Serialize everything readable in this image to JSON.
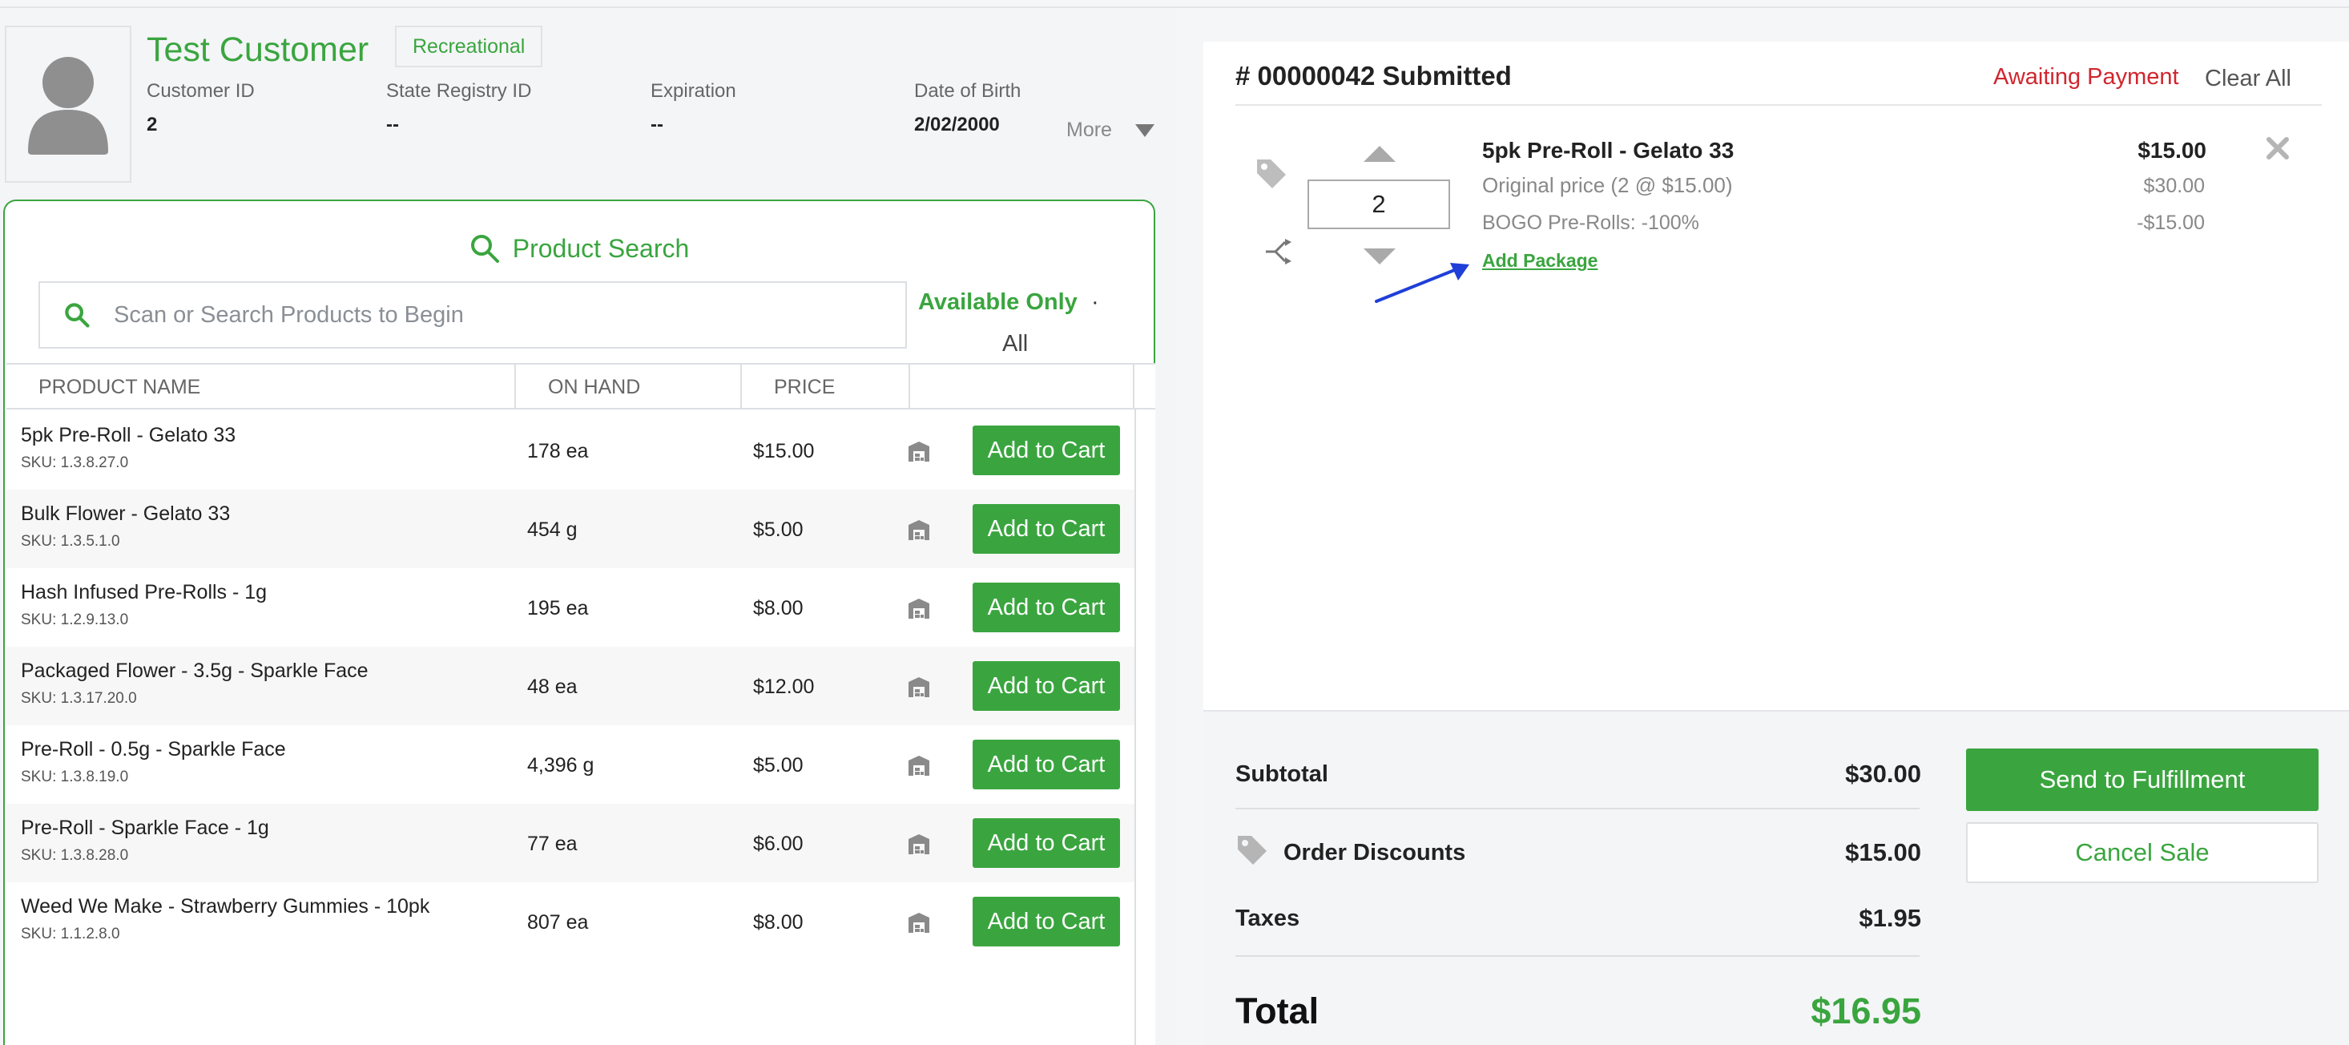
{
  "customer": {
    "name": "Test Customer",
    "type_badge": "Recreational",
    "fields": [
      {
        "label": "Customer ID",
        "value": "2"
      },
      {
        "label": "State Registry ID",
        "value": "--"
      },
      {
        "label": "Expiration",
        "value": "--"
      },
      {
        "label": "Date of Birth",
        "value": "2/02/2000"
      }
    ],
    "more_label": "More"
  },
  "search": {
    "title": "Product Search",
    "placeholder": "Scan or Search Products to Begin",
    "filter_available": "Available Only",
    "filter_separator": "·",
    "filter_all": "All"
  },
  "table": {
    "headers": [
      "PRODUCT NAME",
      "ON HAND",
      "PRICE"
    ],
    "add_label": "Add to Cart",
    "rows": [
      {
        "name": "5pk Pre-Roll - Gelato 33",
        "sku": "SKU: 1.3.8.27.0",
        "on_hand": "178 ea",
        "price": "$15.00"
      },
      {
        "name": "Bulk Flower - Gelato 33",
        "sku": "SKU: 1.3.5.1.0",
        "on_hand": "454 g",
        "price": "$5.00"
      },
      {
        "name": "Hash Infused Pre-Rolls - 1g",
        "sku": "SKU: 1.2.9.13.0",
        "on_hand": "195 ea",
        "price": "$8.00"
      },
      {
        "name": "Packaged Flower - 3.5g - Sparkle Face",
        "sku": "SKU: 1.3.17.20.0",
        "on_hand": "48 ea",
        "price": "$12.00"
      },
      {
        "name": "Pre-Roll - 0.5g - Sparkle Face",
        "sku": "SKU: 1.3.8.19.0",
        "on_hand": "4,396 g",
        "price": "$5.00"
      },
      {
        "name": "Pre-Roll - Sparkle Face - 1g",
        "sku": "SKU: 1.3.8.28.0",
        "on_hand": "77 ea",
        "price": "$6.00"
      },
      {
        "name": "Weed We Make - Strawberry Gummies - 10pk",
        "sku": "SKU: 1.1.2.8.0",
        "on_hand": "807 ea",
        "price": "$8.00"
      }
    ]
  },
  "order": {
    "title": "# 00000042 Submitted",
    "status": "Awaiting Payment",
    "clear_all": "Clear All",
    "item": {
      "quantity": "2",
      "name": "5pk Pre-Roll - Gelato 33",
      "original_price_label": "Original price (2 @ $15.00)",
      "discount_label": "BOGO Pre-Rolls:  -100%",
      "add_package": "Add Package",
      "price": "$15.00",
      "original_total": "$30.00",
      "discount_value": "-$15.00"
    },
    "totals": {
      "subtotal_label": "Subtotal",
      "subtotal": "$30.00",
      "discounts_label": "Order Discounts",
      "discounts": "$15.00",
      "taxes_label": "Taxes",
      "taxes": "$1.95",
      "total_label": "Total",
      "total": "$16.95"
    },
    "fulfill_button": "Send to Fulfillment",
    "cancel_button": "Cancel Sale"
  },
  "colors": {
    "accent_green": "#3aa53f",
    "status_red": "#d0262e",
    "annotation_arrow": "#1f3fd8"
  }
}
